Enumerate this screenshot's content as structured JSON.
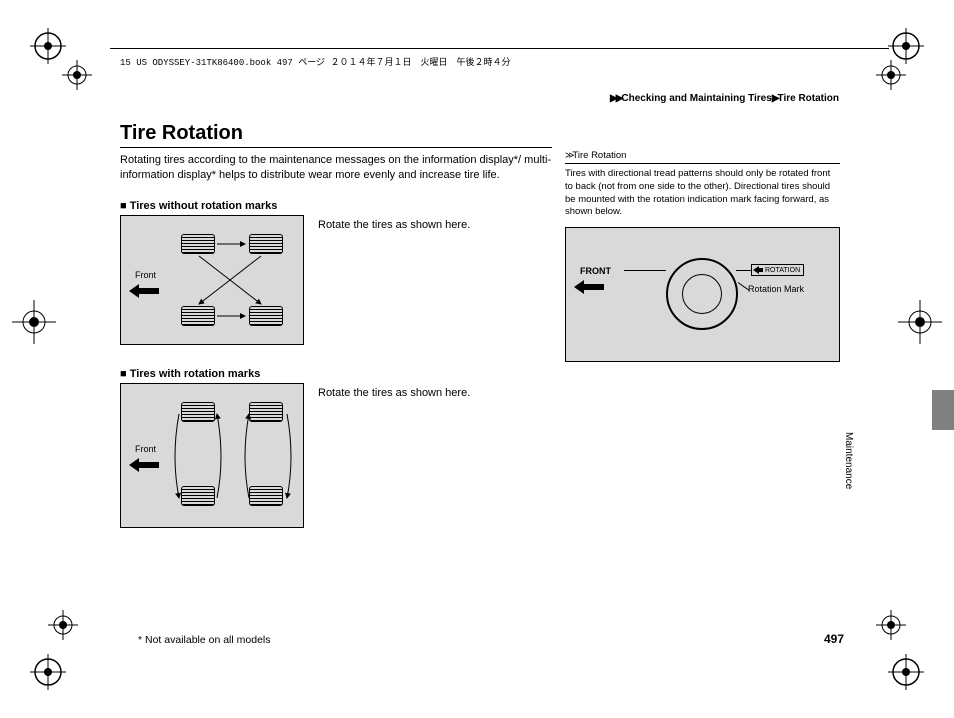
{
  "header": "15 US ODYSSEY-31TK86400.book  497 ページ  ２０１４年７月１日　火曜日　午後２時４分",
  "breadcrumb": {
    "a": "Checking and Maintaining Tires",
    "b": "Tire Rotation"
  },
  "title": "Tire Rotation",
  "intro": "Rotating tires according to the maintenance messages on the information display*/ multi-information display* helps to distribute wear more evenly and increase tire life.",
  "section1": "Tires without rotation marks",
  "rotate1": "Rotate the tires as shown here.",
  "section2": "Tires with rotation marks",
  "rotate2": "Rotate the tires as shown here.",
  "dgFront": "Front",
  "right": {
    "head": "Tire Rotation",
    "body": "Tires with directional tread patterns should only be rotated front to back (not from one side to the other). Directional tires should be mounted with the rotation indication mark facing forward, as shown below.",
    "front": "FRONT",
    "rotationWord": "ROTATION",
    "rotationMark": "Rotation Mark"
  },
  "sideText": "Maintenance",
  "footnote": "* Not available on all models",
  "pageNumber": "497"
}
